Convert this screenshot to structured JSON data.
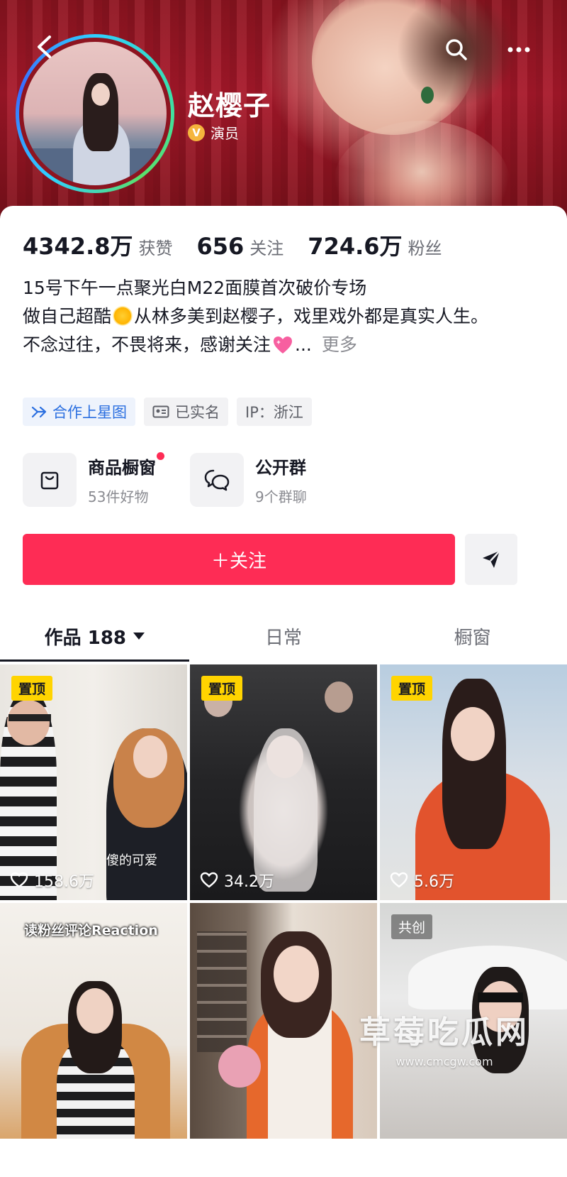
{
  "profile": {
    "name": "赵樱子",
    "verified_label": "演员",
    "verified_badge": "V"
  },
  "stats": [
    {
      "value": "4342.8万",
      "label": "获赞"
    },
    {
      "value": "656",
      "label": "关注"
    },
    {
      "value": "724.6万",
      "label": "粉丝"
    }
  ],
  "bio": {
    "line1": "15号下午一点聚光白M22面膜首次破价专场",
    "line2_a": "做自己超酷",
    "line2_b": "从林多美到赵樱子，戏里戏外都是真实人生。",
    "line3": "不念过往，不畏将来，感谢关注",
    "ellipsis": "...",
    "more": "更多"
  },
  "tags": [
    {
      "label": "合作上星图",
      "icon": "xingtu-icon"
    },
    {
      "label": "已实名",
      "icon": "id-card-icon"
    },
    {
      "label": "IP：浙江",
      "icon": ""
    }
  ],
  "shortcuts": [
    {
      "title": "商品橱窗",
      "subtitle": "53件好物",
      "icon": "shopping-bag-icon",
      "has_dot": true
    },
    {
      "title": "公开群",
      "subtitle": "9个群聊",
      "icon": "group-chat-icon",
      "has_dot": false
    }
  ],
  "follow_button": "＋关注",
  "tabs": [
    {
      "label": "作品 188",
      "active": true
    },
    {
      "label": "日常",
      "active": false
    },
    {
      "label": "橱窗",
      "active": false
    }
  ],
  "videos": [
    {
      "badge": "置顶",
      "likes": "158.6万",
      "caption": "傻的可爱"
    },
    {
      "badge": "置顶",
      "likes": "34.2万"
    },
    {
      "badge": "置顶",
      "likes": "5.6万"
    },
    {
      "title": "读粉丝评论Reaction"
    },
    {},
    {
      "badge": "共创"
    }
  ],
  "watermark": {
    "main": "草莓吃瓜网",
    "sub": "www.cmcgw.com"
  },
  "colors": {
    "accent": "#fe2c55",
    "badge": "#ffd400",
    "link": "#2b6fe0",
    "header": "#a8182a"
  }
}
